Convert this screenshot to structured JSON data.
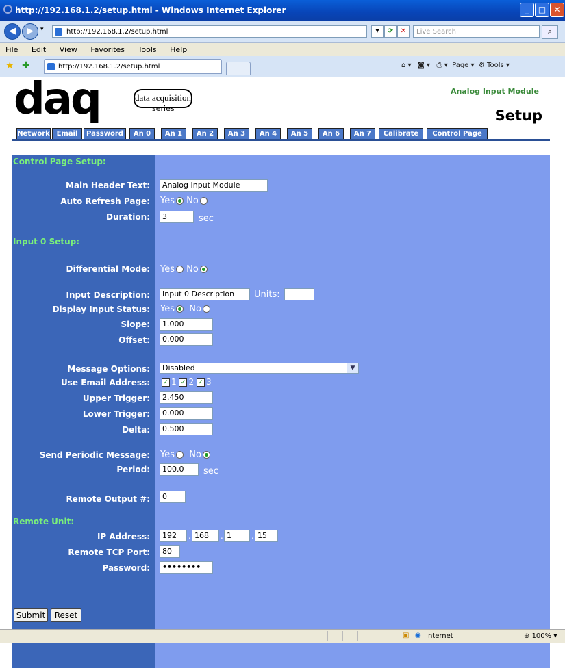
{
  "window": {
    "title": "http://192.168.1.2/setup.html - Windows Internet Explorer"
  },
  "browser": {
    "address": "http://192.168.1.2/setup.html",
    "search_placeholder": "Live Search",
    "menu": [
      "File",
      "Edit",
      "View",
      "Favorites",
      "Tools",
      "Help"
    ],
    "tab_title": "http://192.168.1.2/setup.html",
    "commands": {
      "page": "Page",
      "tools": "Tools"
    }
  },
  "header": {
    "logo_main": "daq",
    "logo_sub": "data acquisition",
    "logo_series": "series",
    "module_title": "Analog Input Module",
    "page_title": "Setup"
  },
  "nav": [
    "Network",
    "Email",
    "Password",
    "An 0",
    "An 1",
    "An 2",
    "An 3",
    "An 4",
    "An 5",
    "An 6",
    "An 7",
    "Calibrate",
    "Control Page"
  ],
  "control_page": {
    "section": "Control Page Setup:",
    "main_header_label": "Main Header Text:",
    "main_header_value": "Analog Input Module",
    "auto_refresh_label": "Auto Refresh Page:",
    "auto_refresh_yes": "Yes",
    "auto_refresh_no": "No",
    "duration_label": "Duration:",
    "duration_value": "3",
    "duration_unit": "sec"
  },
  "input0": {
    "section": "Input 0 Setup:",
    "differential_label": "Differential Mode:",
    "differential_yes": "Yes",
    "differential_no": "No",
    "description_label": "Input Description:",
    "description_value": "Input 0 Description",
    "units_label": "Units:",
    "units_value": "",
    "display_status_label": "Display Input Status:",
    "display_yes": "Yes",
    "display_no": "No",
    "slope_label": "Slope:",
    "slope_value": "1.000",
    "offset_label": "Offset:",
    "offset_value": "0.000",
    "message_options_label": "Message Options:",
    "message_options_value": "Disabled",
    "email_label": "Use Email Address:",
    "email_options": [
      "1",
      "2",
      "3"
    ],
    "upper_label": "Upper Trigger:",
    "upper_value": "2.450",
    "lower_label": "Lower Trigger:",
    "lower_value": "0.000",
    "delta_label": "Delta:",
    "delta_value": "0.500",
    "periodic_label": "Send Periodic Message:",
    "periodic_yes": "Yes",
    "periodic_no": "No",
    "period_label": "Period:",
    "period_value": "100.0",
    "period_unit": "sec",
    "remote_output_label": "Remote Output #:",
    "remote_output_value": "0"
  },
  "remote": {
    "section": "Remote Unit:",
    "ip_label": "IP Address:",
    "ip": [
      "192",
      "168",
      "1",
      "15"
    ],
    "port_label": "Remote TCP Port:",
    "port_value": "80",
    "password_label": "Password:",
    "password_value": "••••••••"
  },
  "buttons": {
    "submit": "Submit",
    "reset": "Reset"
  },
  "status": {
    "zone": "Internet",
    "zoom": "100%"
  }
}
